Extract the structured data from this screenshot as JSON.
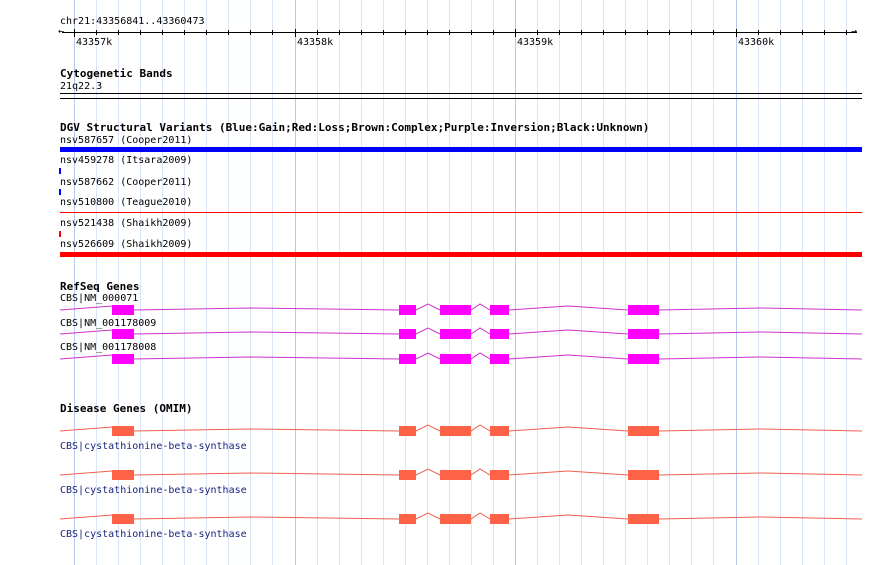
{
  "ruler": {
    "location": "chr21:43356841..43360473",
    "ticks": [
      "43357k",
      "43358k",
      "43359k",
      "43360k"
    ],
    "left_arrow": "←",
    "right_arrow": "→"
  },
  "cytoband": {
    "title": "Cytogenetic Bands",
    "band": "21q22.3"
  },
  "dgv": {
    "title": "DGV Structural Variants (Blue:Gain;Red:Loss;Brown:Complex;Purple:Inversion;Black:Unknown)",
    "items": [
      {
        "label": "nsv587657 (Cooper2011)",
        "color": "#0000ff"
      },
      {
        "label": "nsv459278 (Itsara2009)",
        "color": "#0000ff"
      },
      {
        "label": "nsv587662 (Cooper2011)",
        "color": "#0000ff"
      },
      {
        "label": "nsv510800 (Teague2010)",
        "color": "#ff0000"
      },
      {
        "label": "nsv521438 (Shaikh2009)",
        "color": "#ff0000"
      },
      {
        "label": "nsv526609 (Shaikh2009)",
        "color": "#ff0000"
      }
    ]
  },
  "refseq": {
    "title": "RefSeq Genes",
    "color": "#ff00ff",
    "line_color": "#cc33cc",
    "transcripts": [
      {
        "label": "CBS|NM_000071"
      },
      {
        "label": "CBS|NM_001178009"
      },
      {
        "label": "CBS|NM_001178008"
      }
    ]
  },
  "disease": {
    "title": "Disease Genes (OMIM)",
    "color": "#ff6347",
    "line_color": "#f06050",
    "genes": [
      {
        "label": "CBS|cystathionine-beta-synthase"
      },
      {
        "label": "CBS|cystathionine-beta-synthase"
      },
      {
        "label": "CBS|cystathionine-beta-synthase"
      }
    ]
  }
}
